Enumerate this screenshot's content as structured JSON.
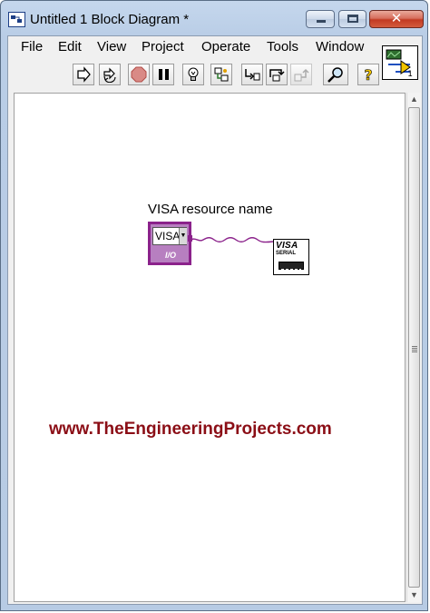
{
  "window": {
    "title": "Untitled 1 Block Diagram *",
    "close_glyph": "✕"
  },
  "menu": [
    "File",
    "Edit",
    "View",
    "Project",
    "Operate",
    "Tools",
    "Window"
  ],
  "toolbar": {
    "buttons": [
      "run-arrow-icon",
      "run-continuously-icon",
      "abort-stop-icon",
      "pause-icon",
      "highlight-execution-bulb-icon",
      "retain-wire-values-icon",
      "step-into-icon",
      "step-over-icon",
      "step-out-icon",
      "search-icon",
      "context-help-icon"
    ],
    "vi_icon_number": "1"
  },
  "diagram": {
    "control_label": "VISA resource name",
    "constant_text": "VISA",
    "constant_type_tag": "I/O",
    "serial_node_title": "VISA",
    "serial_node_sub": "SERIAL",
    "wire_color": "#8b228b"
  },
  "watermark": "www.TheEngineeringProjects.com",
  "colors": {
    "titlebar": "#c5d7ed",
    "visa_purple": "#8b228b",
    "watermark": "#8b0e16"
  }
}
